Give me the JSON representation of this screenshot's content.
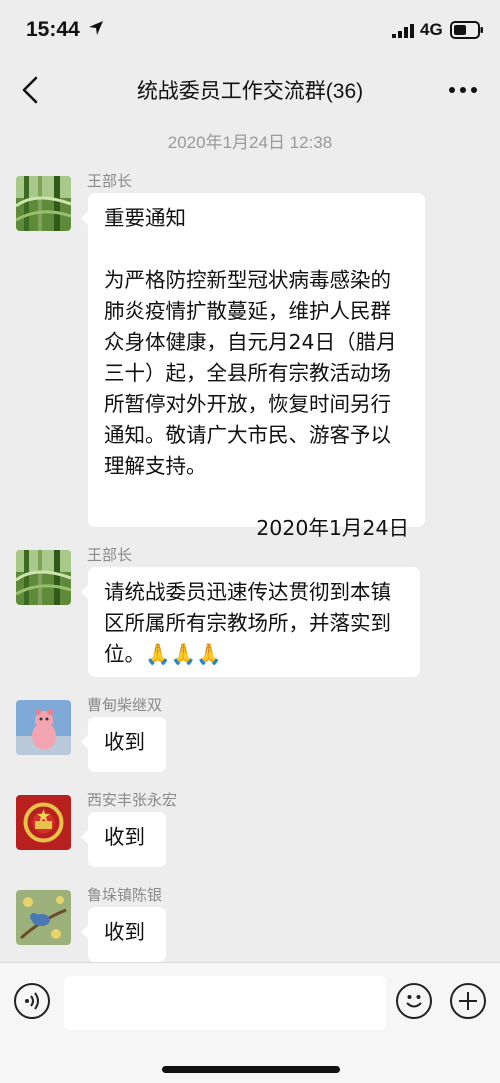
{
  "status_bar": {
    "time": "15:44",
    "network": "4G"
  },
  "nav": {
    "title": "统战委员工作交流群(36)"
  },
  "timestamp": "2020年1月24日 12:38",
  "messages": [
    {
      "sender": "王部长",
      "avatar_icon": "bamboo-avatar-icon",
      "title": "重要通知",
      "body": "为严格防控新型冠状病毒感染的肺炎疫情扩散蔓延，维护人民群众身体健康，自元月24日（腊月三十）起，全县所有宗教活动场所暂停对外开放，恢复时间另行通知。敬请广大市民、游客予以理解支持。",
      "date": "2020年1月24日"
    },
    {
      "sender": "王部长",
      "avatar_icon": "bamboo-avatar-icon",
      "body": "请统战委员迅速传达贯彻到本镇区所属所有宗教场所，并落实到位。🙏🙏🙏"
    },
    {
      "sender": "曹甸柴继双",
      "avatar_icon": "pink-toy-avatar-icon",
      "body": "收到"
    },
    {
      "sender": "西安丰张永宏",
      "avatar_icon": "emblem-avatar-icon",
      "body": "收到"
    },
    {
      "sender": "鲁垛镇陈银",
      "avatar_icon": "bird-avatar-icon",
      "body": "收到"
    }
  ],
  "input": {
    "placeholder": ""
  },
  "colors": {
    "background": "#ededed",
    "bubble": "#ffffff",
    "timestamp": "#9a9a9a"
  }
}
